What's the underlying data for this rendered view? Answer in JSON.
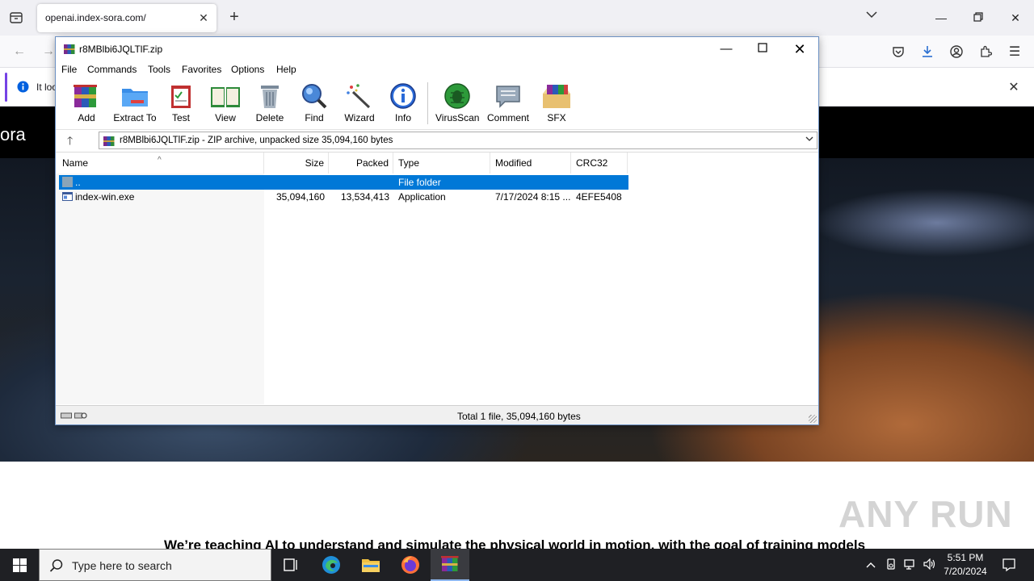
{
  "browser": {
    "tab_title": "openai.index-sora.com/",
    "infobar_text": "It loo"
  },
  "webpage": {
    "logo_text": "ora",
    "body_text": "We’re teaching AI to understand and simulate the physical world in motion, with the goal of training models",
    "watermark": "ANY RUN"
  },
  "winrar": {
    "title": "r8MBlbi6JQLTlF.zip",
    "menu": [
      "File",
      "Commands",
      "Tools",
      "Favorites",
      "Options",
      "Help"
    ],
    "toolbar": [
      "Add",
      "Extract To",
      "Test",
      "View",
      "Delete",
      "Find",
      "Wizard",
      "Info",
      "VirusScan",
      "Comment",
      "SFX"
    ],
    "address": "r8MBlbi6JQLTlF.zip - ZIP archive, unpacked size 35,094,160 bytes",
    "columns": [
      "Name",
      "Size",
      "Packed",
      "Type",
      "Modified",
      "CRC32"
    ],
    "rows": [
      {
        "name": "..",
        "size": "",
        "packed": "",
        "type": "File folder",
        "modified": "",
        "crc": ""
      },
      {
        "name": "index-win.exe",
        "size": "35,094,160",
        "packed": "13,534,413",
        "type": "Application",
        "modified": "7/17/2024 8:15 ...",
        "crc": "4EFE5408"
      }
    ],
    "status": "Total 1 file, 35,094,160 bytes"
  },
  "taskbar": {
    "search_placeholder": "Type here to search",
    "time": "5:51 PM",
    "date": "7/20/2024"
  },
  "colors": {
    "selection": "#0078d7",
    "taskbar": "#1f2024"
  }
}
